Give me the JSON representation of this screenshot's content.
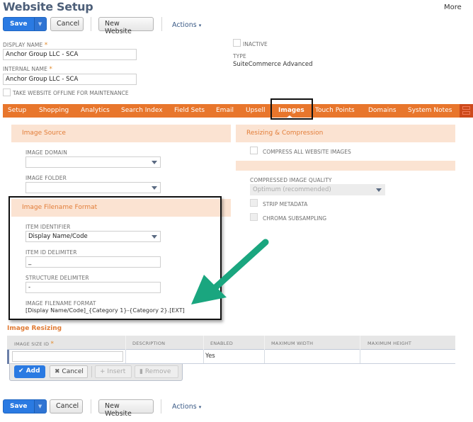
{
  "page": {
    "title": "Website Setup",
    "more_label": "More"
  },
  "toolbar": {
    "save_label": "Save",
    "save_dropdown_icon": "caret-down-icon",
    "cancel_label": "Cancel",
    "new_website_label": "New Website",
    "actions_label": "Actions",
    "actions_caret": "▾"
  },
  "header_fields": {
    "display_name": {
      "label": "DISPLAY NAME",
      "required_mark": "*",
      "value": "Anchor Group LLC - SCA"
    },
    "internal_name": {
      "label": "INTERNAL NAME",
      "required_mark": "*",
      "value": "Anchor Group LLC - SCA"
    },
    "offline": {
      "label": "TAKE WEBSITE OFFLINE FOR MAINTENANCE",
      "checked": false
    },
    "inactive": {
      "label": "INACTIVE",
      "checked": false
    },
    "type": {
      "label": "TYPE",
      "value": "SuiteCommerce Advanced"
    }
  },
  "tabs": [
    {
      "label": "Setup",
      "active": false
    },
    {
      "label": "Shopping",
      "active": false
    },
    {
      "label": "Analytics",
      "active": false
    },
    {
      "label": "Search Index",
      "active": false
    },
    {
      "label": "Field Sets",
      "active": false
    },
    {
      "label": "Email",
      "active": false
    },
    {
      "label": "Upsell",
      "active": false
    },
    {
      "label": "Images",
      "active": true
    },
    {
      "label": "Touch Points",
      "active": false
    },
    {
      "label": "Domains",
      "active": false
    },
    {
      "label": "System Notes",
      "active": false
    }
  ],
  "image_source": {
    "title": "Image Source",
    "image_domain": {
      "label": "IMAGE DOMAIN",
      "value": ""
    },
    "image_folder": {
      "label": "IMAGE FOLDER",
      "value": ""
    }
  },
  "resizing_compression": {
    "title": "Resizing & Compression",
    "compress_all": {
      "label": "COMPRESS ALL WEBSITE IMAGES",
      "checked": false
    },
    "quality": {
      "label": "COMPRESSED IMAGE QUALITY",
      "value": "Optimum (recommended)",
      "disabled": true
    },
    "strip_metadata": {
      "label": "STRIP METADATA",
      "checked": false,
      "disabled": true
    },
    "chroma": {
      "label": "CHROMA SUBSAMPLING",
      "checked": false,
      "disabled": true
    }
  },
  "filename_format": {
    "title": "Image Filename Format",
    "item_identifier": {
      "label": "ITEM IDENTIFIER",
      "value": "Display Name/Code"
    },
    "item_id_delimiter": {
      "label": "ITEM ID DELIMITER",
      "value": "_"
    },
    "structure_delimiter": {
      "label": "STRUCTURE DELIMITER",
      "value": "-"
    },
    "format": {
      "label": "IMAGE FILENAME FORMAT",
      "value": "[Display Name/Code]_{Category 1}-{Category 2}.[EXT]"
    }
  },
  "image_resizing": {
    "title": "Image Resizing",
    "columns": [
      "IMAGE SIZE ID",
      "DESCRIPTION",
      "ENABLED",
      "MAXIMUM WIDTH",
      "MAXIMUM HEIGHT"
    ],
    "required_mark": "*",
    "rows": [
      {
        "image_size_id": "",
        "description": "",
        "enabled": "Yes",
        "max_width": "",
        "max_height": ""
      }
    ],
    "buttons": {
      "add": "Add",
      "cancel": "Cancel",
      "insert": "Insert",
      "remove": "Remove"
    }
  },
  "annotation": {
    "arrow_color": "#1aa67f",
    "highlight_color": "#111111"
  }
}
